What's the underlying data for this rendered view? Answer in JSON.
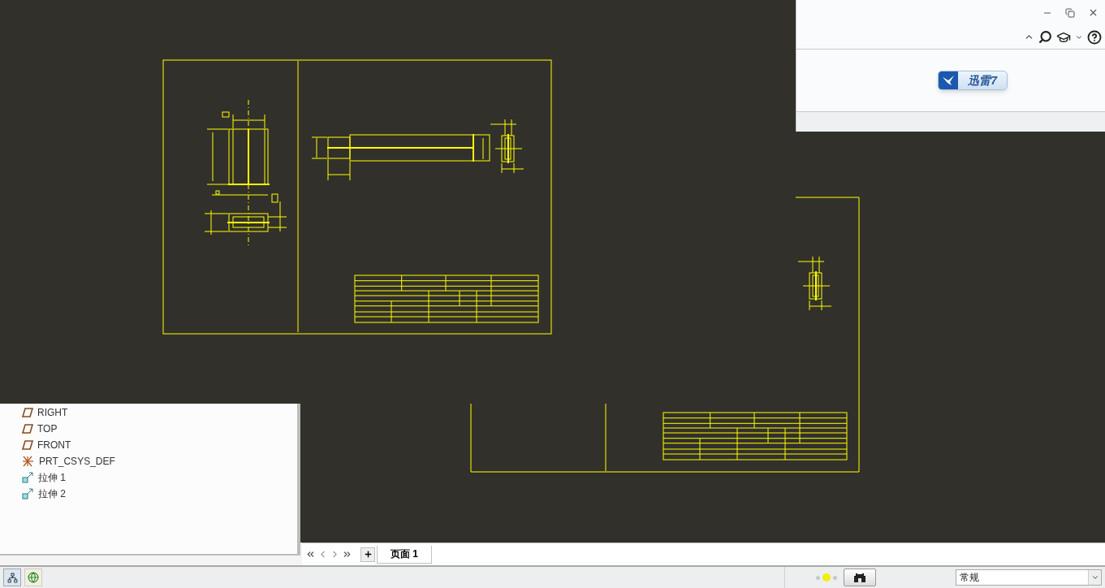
{
  "top_panel": {
    "launcher_button": "迅雷7"
  },
  "model_tree": {
    "items": [
      {
        "kind": "plane",
        "label": "RIGHT"
      },
      {
        "kind": "plane",
        "label": "TOP"
      },
      {
        "kind": "plane",
        "label": "FRONT"
      },
      {
        "kind": "csys",
        "label": "PRT_CSYS_DEF"
      },
      {
        "kind": "extrude",
        "label": "拉伸 1"
      },
      {
        "kind": "extrude",
        "label": "拉伸 2"
      }
    ]
  },
  "sheet_tabs": [
    {
      "label": "页面 1",
      "selected": true
    }
  ],
  "status_bar": {
    "filter": "常规"
  }
}
